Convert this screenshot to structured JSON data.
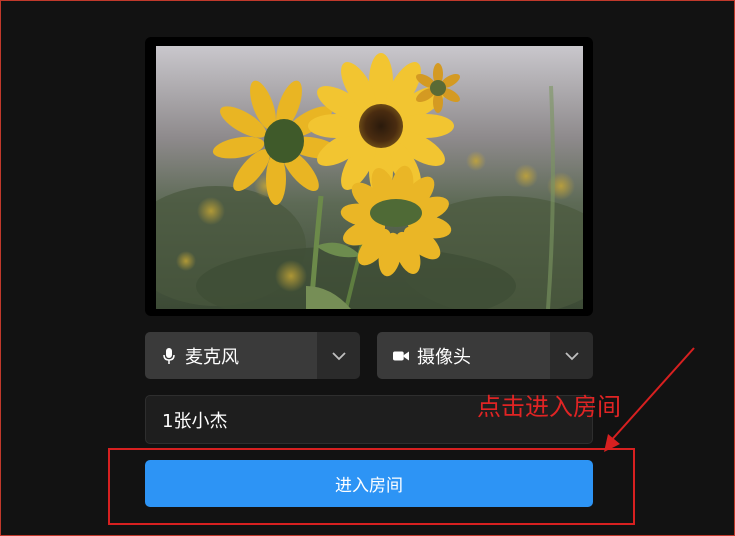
{
  "preview": {
    "subject": "sunflower-camera-preview"
  },
  "devices": {
    "microphone": {
      "label": "麦克风",
      "icon": "microphone-icon"
    },
    "camera": {
      "label": "摄像头",
      "icon": "video-camera-icon"
    }
  },
  "name_field": {
    "value": "1张小杰"
  },
  "enter_button": {
    "label": "进入房间"
  },
  "annotation": {
    "text": "点击进入房间",
    "color": "#e02424"
  },
  "colors": {
    "background": "#121212",
    "primary": "#2d94f5",
    "annotation": "#d72020"
  }
}
